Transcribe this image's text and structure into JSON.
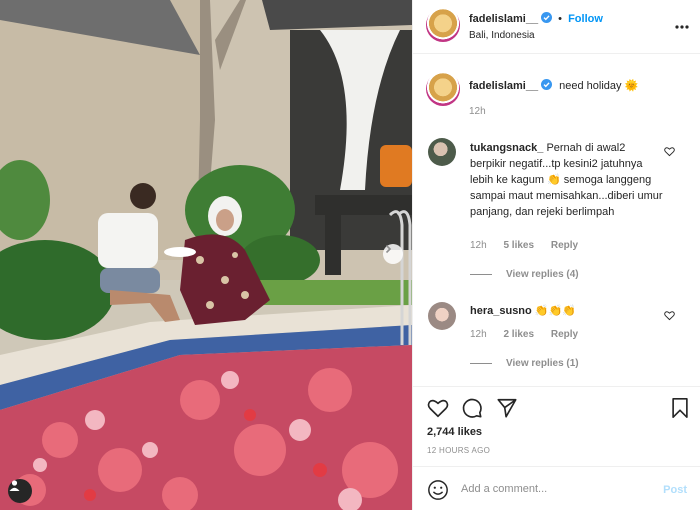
{
  "post": {
    "author": "fadelislami__",
    "location": "Bali, Indonesia",
    "follow_label": "Follow",
    "dot": "•",
    "photo_description": "couple sitting by a pool covered in flower petals"
  },
  "caption": {
    "username": "fadelislami__",
    "text": "need holiday 🌞",
    "time": "12h"
  },
  "comments": [
    {
      "username": "tukangsnack_",
      "text": "Pernah di awal2 berpikir negatif...tp kesini2 jatuhnya lebih ke kagum 👏 semoga langgeng sampai maut memisahkan...diberi umur panjang, dan rejeki berlimpah",
      "time": "12h",
      "likes": "5 likes",
      "reply_label": "Reply",
      "view_replies": "View replies (4)"
    },
    {
      "username": "hera_susno",
      "text": "👏👏👏",
      "time": "12h",
      "likes": "2 likes",
      "reply_label": "Reply",
      "view_replies": "View replies (1)"
    }
  ],
  "footer": {
    "likes": "2,744 likes",
    "timestamp": "12 HOURS AGO"
  },
  "composer": {
    "placeholder": "Add a comment...",
    "post_label": "Post"
  },
  "colors": {
    "accent": "#0095f6",
    "post_disabled": "#b2dffc",
    "muted": "#8e8e8e",
    "text": "#262626"
  },
  "icons": {
    "more": "more-horizontal-icon",
    "like": "heart-icon",
    "comment": "comment-bubble-icon",
    "share": "paper-plane-icon",
    "save": "bookmark-icon",
    "emoji": "smiley-icon",
    "tag": "user-tag-icon",
    "next": "chevron-right-icon",
    "verified": "verified-badge-icon"
  }
}
